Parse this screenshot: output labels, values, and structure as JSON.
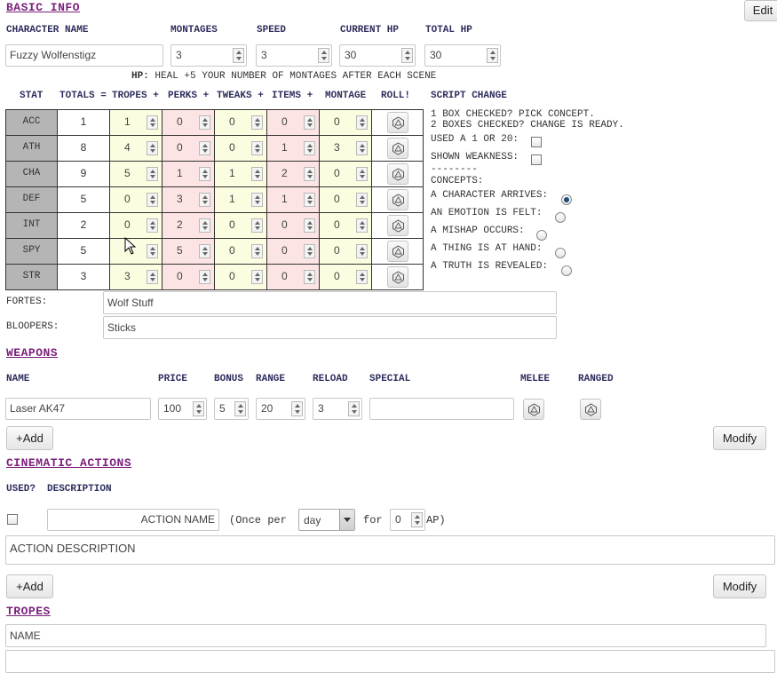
{
  "header": {
    "edit_label": "Edit"
  },
  "basic_info": {
    "title": "BASIC INFO",
    "labels": {
      "character_name": "CHARACTER NAME",
      "montages": "MONTAGES",
      "speed": "SPEED",
      "current_hp": "CURRENT HP",
      "total_hp": "TOTAL HP"
    },
    "character_name": "Fuzzy Wolfenstigz",
    "montages": "3",
    "speed": "3",
    "current_hp": "30",
    "total_hp": "30",
    "hp_note_label": "HP:",
    "hp_note": "HEAL +5 YOUR NUMBER OF MONTAGES AFTER EACH SCENE"
  },
  "stats": {
    "headers": {
      "stat": "STAT",
      "totals": "TOTALS =",
      "tropes": "TROPES +",
      "perks": "PERKS +",
      "tweaks": "TWEAKS +",
      "items": "ITEMS +",
      "montage": "MONTAGE",
      "roll": "ROLL!"
    },
    "rows": [
      {
        "stat": "ACC",
        "total": "1",
        "tropes": "1",
        "perks": "0",
        "tweaks": "0",
        "items": "0",
        "montage": "0"
      },
      {
        "stat": "ATH",
        "total": "8",
        "tropes": "4",
        "perks": "0",
        "tweaks": "0",
        "items": "1",
        "montage": "3"
      },
      {
        "stat": "CHA",
        "total": "9",
        "tropes": "5",
        "perks": "1",
        "tweaks": "1",
        "items": "2",
        "montage": "0"
      },
      {
        "stat": "DEF",
        "total": "5",
        "tropes": "0",
        "perks": "3",
        "tweaks": "1",
        "items": "1",
        "montage": "0"
      },
      {
        "stat": "INT",
        "total": "2",
        "tropes": "0",
        "perks": "2",
        "tweaks": "0",
        "items": "0",
        "montage": "0"
      },
      {
        "stat": "SPY",
        "total": "5",
        "tropes": "",
        "perks": "5",
        "tweaks": "0",
        "items": "0",
        "montage": "0"
      },
      {
        "stat": "STR",
        "total": "3",
        "tropes": "3",
        "perks": "0",
        "tweaks": "0",
        "items": "0",
        "montage": "0"
      }
    ]
  },
  "script_change": {
    "title": "SCRIPT CHANGE",
    "line1": "1 BOX CHECKED? PICK CONCEPT.",
    "line2": "2 BOXES CHECKED? CHANGE IS READY.",
    "used_label": "USED A 1 OR 20:",
    "weakness_label": "SHOWN WEAKNESS:",
    "divider": "--------",
    "concepts_label": "CONCEPTS:",
    "concepts": [
      {
        "label": "A CHARACTER ARRIVES:",
        "selected": true
      },
      {
        "label": "AN EMOTION IS FELT:",
        "selected": false
      },
      {
        "label": "A MISHAP OCCURS:",
        "selected": false
      },
      {
        "label": "A THING IS AT HAND:",
        "selected": false
      },
      {
        "label": "A TRUTH IS REVEALED:",
        "selected": false
      }
    ]
  },
  "fortes": {
    "label": "FORTES:",
    "value": "Wolf Stuff"
  },
  "bloopers": {
    "label": "BLOOPERS:",
    "value": "Sticks"
  },
  "weapons": {
    "title": "WEAPONS",
    "headers": {
      "name": "NAME",
      "price": "PRICE",
      "bonus": "BONUS",
      "range": "RANGE",
      "reload": "RELOAD",
      "special": "SPECIAL",
      "melee": "MELEE",
      "ranged": "RANGED"
    },
    "row": {
      "name": "Laser AK47",
      "price": "100",
      "bonus": "5",
      "range": "20",
      "reload": "3",
      "special": ""
    },
    "add_label": "+Add",
    "modify_label": "Modify"
  },
  "cinematic": {
    "title": "CINEMATIC ACTIONS",
    "headers": {
      "used": "USED?",
      "description": "DESCRIPTION"
    },
    "action_name_placeholder": "ACTION NAME",
    "once_per": "(Once per",
    "period": "day",
    "for": "for",
    "ap_value": "0",
    "ap_suffix": "AP)",
    "description_placeholder": "ACTION DESCRIPTION",
    "add_label": "+Add",
    "modify_label": "Modify"
  },
  "tropes": {
    "title": "TROPES",
    "name_placeholder": "NAME"
  },
  "colors": {
    "section_title": "#7b1f7b",
    "tropes_col": "#fcfce0",
    "perks_col": "#fde4e4",
    "stat_col": "#b5b5b5"
  }
}
